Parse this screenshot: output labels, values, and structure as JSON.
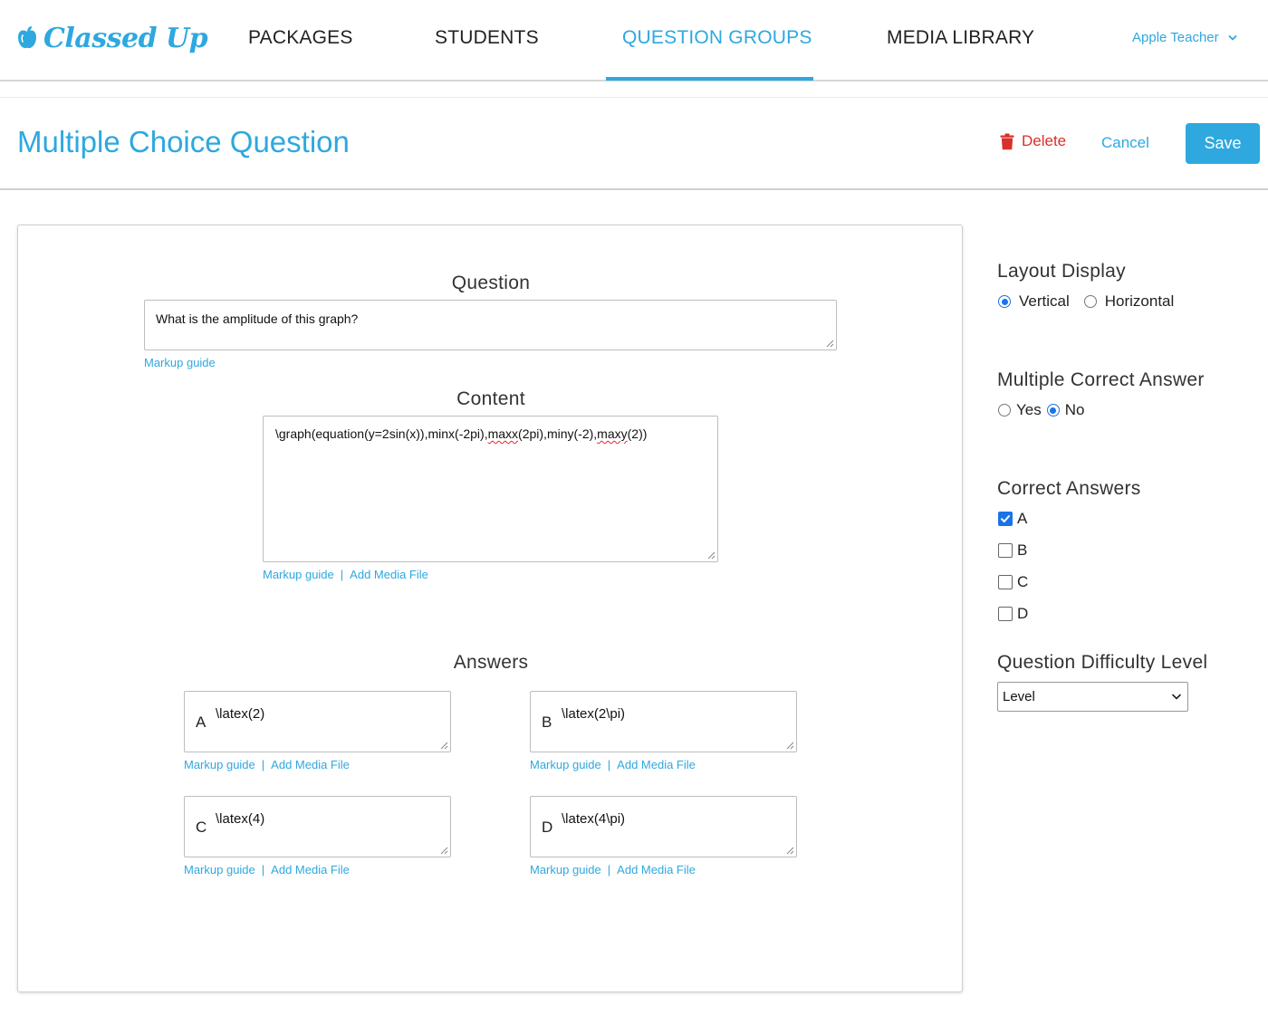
{
  "app": {
    "brand": "Classed Up",
    "accent_color": "#2ea8df",
    "danger_color": "#d8302a"
  },
  "nav": {
    "items": [
      {
        "label": "PACKAGES",
        "active": false
      },
      {
        "label": "STUDENTS",
        "active": false
      },
      {
        "label": "QUESTION GROUPS",
        "active": true
      },
      {
        "label": "MEDIA LIBRARY",
        "active": false
      }
    ],
    "user": "Apple Teacher",
    "user_icon": "chevron-down-icon"
  },
  "header": {
    "title": "Multiple Choice Question",
    "delete_label": "Delete",
    "delete_icon": "trash-icon",
    "cancel_label": "Cancel",
    "save_label": "Save"
  },
  "form": {
    "question": {
      "label": "Question",
      "value": "What is the amplitude of this graph?",
      "markup_link": "Markup guide"
    },
    "content": {
      "label": "Content",
      "value_parts": [
        "\\graph(equation(y=2sin(x)),minx(-2pi),",
        "maxx",
        "(2pi),miny(-2),",
        "maxy",
        "(2))"
      ],
      "markup_link": "Markup guide",
      "media_link": "Add Media File",
      "separator": "|"
    },
    "answers": {
      "label": "Answers",
      "markup_link": "Markup guide",
      "media_link": "Add Media File",
      "separator": "|",
      "items": [
        {
          "letter": "A",
          "value": "\\latex(2)"
        },
        {
          "letter": "B",
          "value": "\\latex(2\\pi)"
        },
        {
          "letter": "C",
          "value": "\\latex(4)"
        },
        {
          "letter": "D",
          "value": "\\latex(4\\pi)"
        }
      ]
    }
  },
  "sidebar": {
    "layout_display": {
      "heading": "Layout Display",
      "options": [
        {
          "label": "Vertical",
          "selected": true
        },
        {
          "label": "Horizontal",
          "selected": false
        }
      ]
    },
    "multiple_correct": {
      "heading": "Multiple Correct Answer",
      "options": [
        {
          "label": "Yes",
          "selected": false
        },
        {
          "label": "No",
          "selected": true
        }
      ]
    },
    "correct_answers": {
      "heading": "Correct Answers",
      "options": [
        {
          "label": "A",
          "checked": true
        },
        {
          "label": "B",
          "checked": false
        },
        {
          "label": "C",
          "checked": false
        },
        {
          "label": "D",
          "checked": false
        }
      ]
    },
    "difficulty": {
      "heading": "Question Difficulty Level",
      "selected": "Level"
    }
  }
}
